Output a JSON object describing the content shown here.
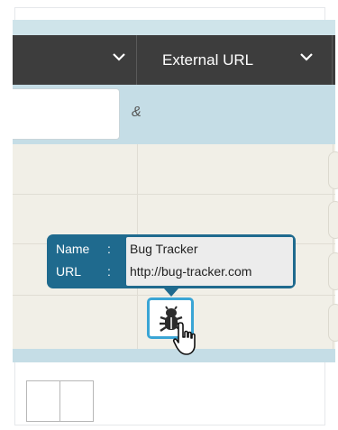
{
  "table": {
    "columns": [
      {
        "label": ""
      },
      {
        "label": "External URL"
      }
    ],
    "filter": {
      "value": "",
      "operator_symbol": "&"
    }
  },
  "tooltip": {
    "name_key": "Name",
    "url_key": "URL",
    "separator": ":",
    "name_value": "Bug Tracker",
    "url_value": "http://bug-tracker.com"
  },
  "icons": {
    "cell_icon": "bug-icon",
    "cursor": "hand-pointer-icon",
    "column_menu": "chevron-down-icon"
  },
  "colors": {
    "header_bg": "#3d3d3d",
    "filter_band": "#c5dde6",
    "tooltip_bg": "#1f6a8e",
    "icon_border": "#3aa5d5",
    "grid_bg": "#f1efe7"
  }
}
